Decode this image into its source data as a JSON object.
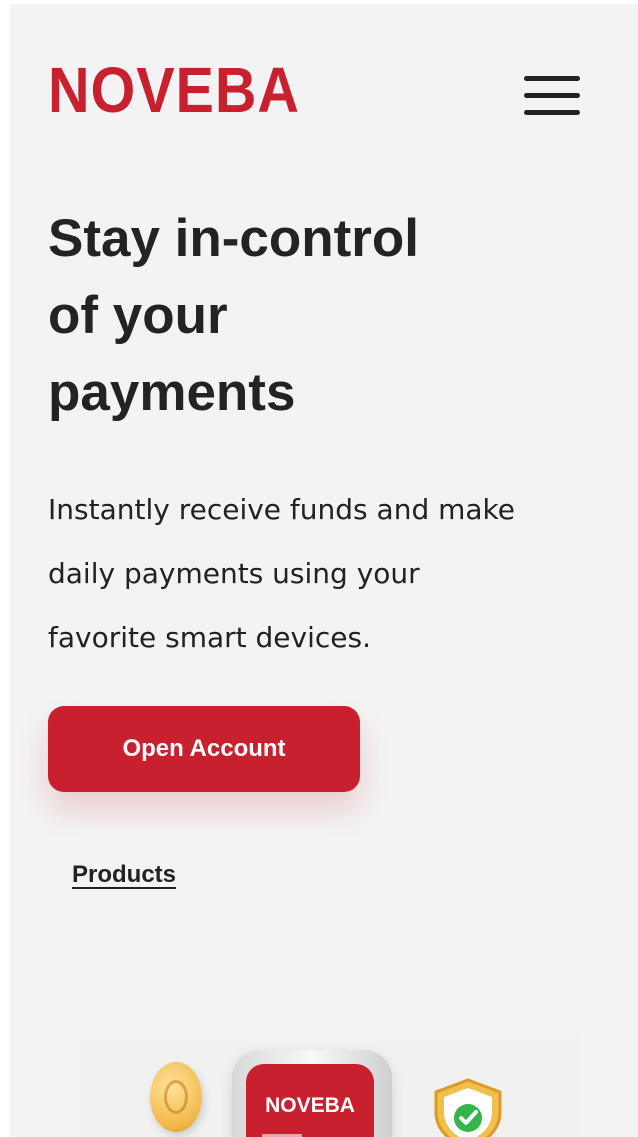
{
  "header": {
    "logo_text": "NOVEBA",
    "menu_icon": "hamburger-menu-icon"
  },
  "hero": {
    "headline_lines": [
      "Stay in-control",
      "of your",
      "payments"
    ],
    "subtext_lines": [
      "Instantly receive funds and make",
      "daily payments using your",
      "favorite smart devices."
    ],
    "cta_label": "Open Account",
    "products_link": "Products"
  },
  "illustration": {
    "device_logo": "NOVEBA",
    "icons": [
      "euro-coin-icon",
      "smartwatch-icon",
      "shield-check-icon"
    ]
  },
  "colors": {
    "brand_red": "#c8202f",
    "background": "#f3f3f3",
    "text_dark": "#232323",
    "coin_gold": "#f2b84a",
    "check_green": "#34b44a"
  }
}
